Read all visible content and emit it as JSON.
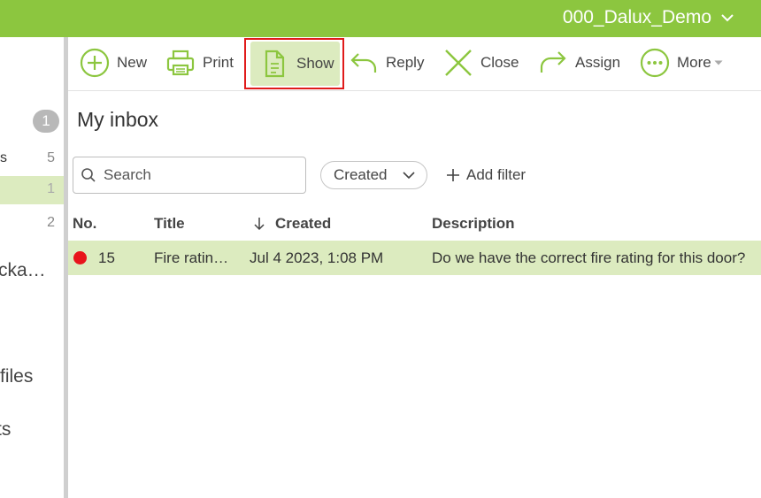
{
  "header": {
    "project_name": "000_Dalux_Demo",
    "bg_color": "#8cc63f"
  },
  "sidebar": {
    "inbox_badge": "1",
    "items": [
      {
        "label": "s",
        "count": "5"
      },
      {
        "label": "",
        "count": "1"
      },
      {
        "label": "",
        "count": "2"
      }
    ],
    "truncated_1": "cka…",
    "truncated_2": "files",
    "truncated_3": "ts"
  },
  "toolbar": {
    "new_label": "New",
    "print_label": "Print",
    "show_label": "Show",
    "reply_label": "Reply",
    "close_label": "Close",
    "assign_label": "Assign",
    "more_label": "More"
  },
  "main": {
    "title": "My inbox",
    "search": {
      "placeholder": "Search",
      "value": ""
    },
    "sort_dropdown": "Created",
    "add_filter_label": "Add filter",
    "columns": {
      "no": "No.",
      "title": "Title",
      "created": "Created",
      "description": "Description"
    },
    "rows": [
      {
        "status_color": "#e8141b",
        "no": "15",
        "title": "Fire ratin…",
        "created": "Jul 4 2023, 1:08 PM",
        "description": "Do we have the correct fire rating for this door?"
      }
    ]
  },
  "colors": {
    "accent": "#8cc63f",
    "selected_row": "#dcebbf",
    "highlight": "#e01b1b"
  }
}
